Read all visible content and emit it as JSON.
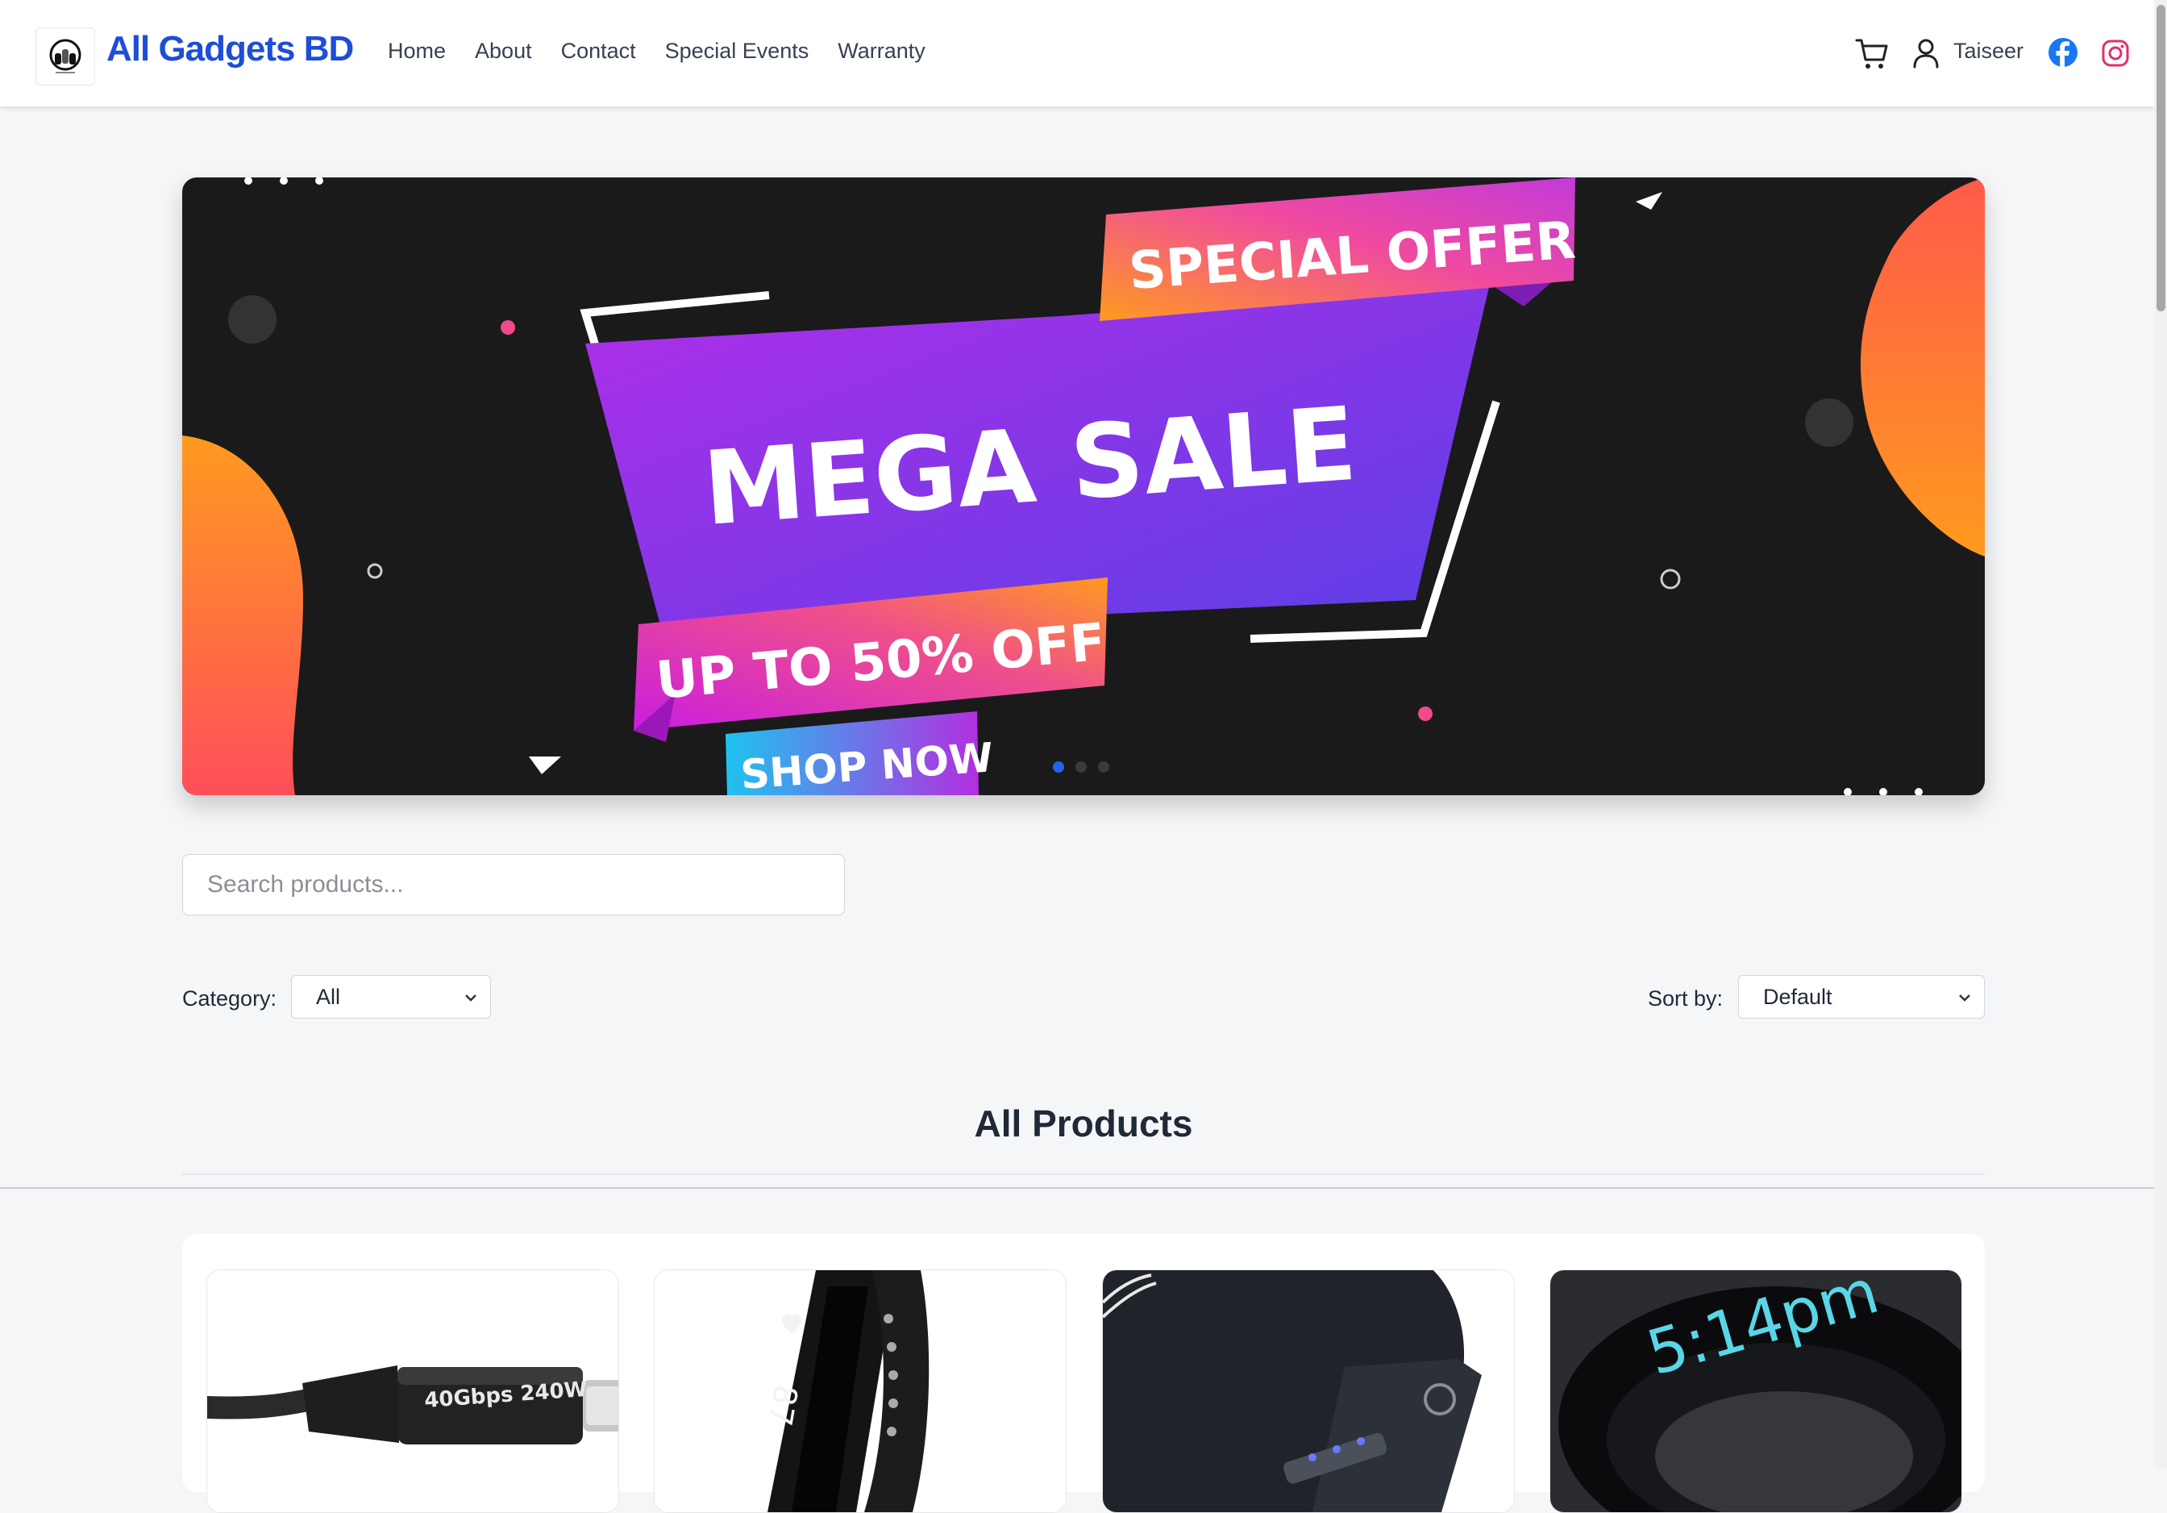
{
  "nav": {
    "brand": "All Gadgets BD",
    "links": [
      "Home",
      "About",
      "Contact",
      "Special Events",
      "Warranty"
    ],
    "username": "Taiseer",
    "icons": [
      "cart-icon",
      "user-icon",
      "facebook-icon",
      "instagram-icon"
    ],
    "brand_color": "#1d4ed8",
    "facebook_color": "#1877f2",
    "instagram_color": "#e1306c"
  },
  "banner": {
    "line1": "SPECIAL OFFER",
    "line2": "MEGA SALE",
    "line3": "UP TO 50% OFF",
    "line4": "SHOP NOW",
    "slides": 3,
    "active_slide": 1
  },
  "search": {
    "placeholder": "Search products...",
    "value": ""
  },
  "filters": {
    "category_label": "Category:",
    "category_value": "All",
    "sort_label": "Sort by:",
    "sort_value": "Default"
  },
  "products": {
    "title": "All Products",
    "items": [
      {
        "image": "usb-c-cable",
        "label": "40Gbps 240W"
      },
      {
        "image": "fitness-band",
        "label": "87"
      },
      {
        "image": "power-bank",
        "label": ""
      },
      {
        "image": "smart-ring",
        "label": "5:14pm"
      }
    ]
  }
}
